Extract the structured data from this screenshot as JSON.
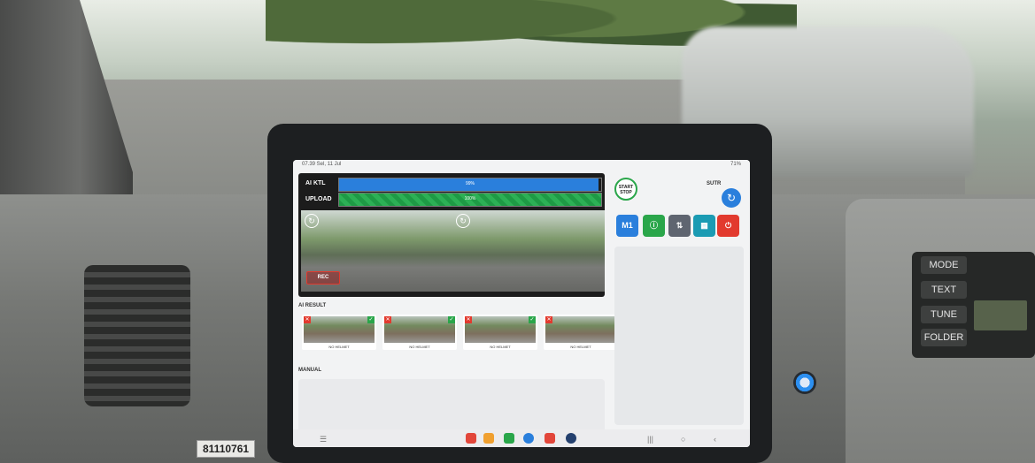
{
  "scene": {
    "vehicle_sticker": "81110761",
    "radio_buttons": [
      "MODE",
      "TEXT",
      "TUNE",
      "FOLDER"
    ]
  },
  "tablet": {
    "status_bar": {
      "time": "07.39  Sel, 11 Jul",
      "right": "71%"
    },
    "ai_ktl": {
      "label": "AI KTL",
      "percent": "99%",
      "progress": 0.99
    },
    "upload": {
      "label": "UPLOAD",
      "percent": "100%",
      "progress": 1.0
    },
    "rec_label": "REC",
    "ai_result_label": "AI RESULT",
    "results": [
      {
        "caption": "NO HELMET"
      },
      {
        "caption": "NO HELMET"
      },
      {
        "caption": "NO HELMET"
      },
      {
        "caption": "NO HELMET"
      }
    ],
    "manual_label": "MANUAL",
    "start_stop_label": "START STOP",
    "user_name": "SUTR",
    "toolbar": {
      "m1_label": "M1",
      "colors": {
        "m1": "#2a7fdc",
        "info": "#2aa64a",
        "sort": "#5f6570",
        "calendar": "#1b9bb3",
        "power": "#e23a2e"
      }
    }
  }
}
